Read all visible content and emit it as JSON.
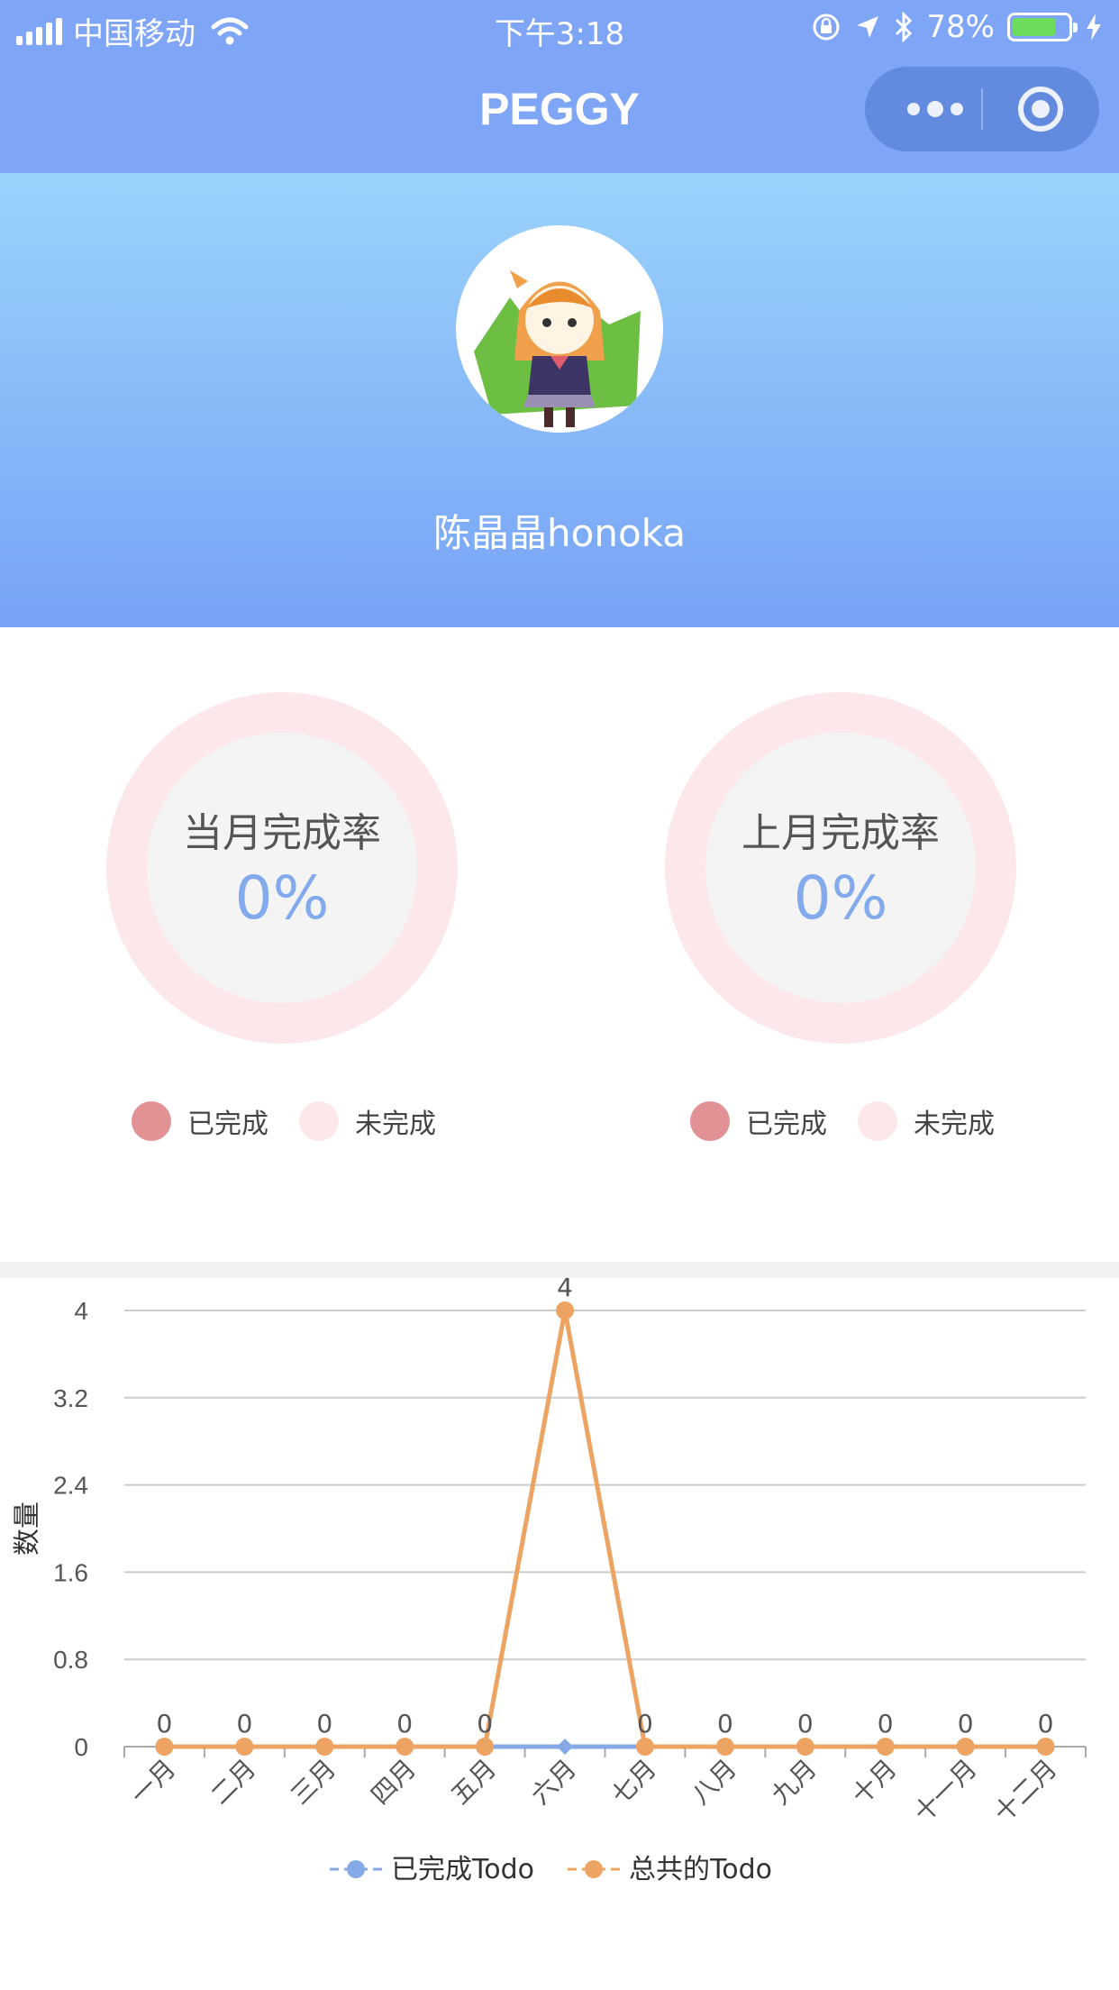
{
  "status_bar": {
    "carrier": "中国移动",
    "time": "下午3:18",
    "battery": "78%",
    "battery_level": 0.78
  },
  "nav": {
    "title": "PEGGY"
  },
  "profile": {
    "username": "陈晶晶honoka"
  },
  "rates": [
    {
      "label": "当月完成率",
      "value": "0%"
    },
    {
      "label": "上月完成率",
      "value": "0%"
    }
  ],
  "legend": {
    "done": "已完成",
    "undone": "未完成"
  },
  "colors": {
    "accent": "#7fa5f7",
    "done": "#e29195",
    "undone": "#fce8ea",
    "rate_text": "#83aaec",
    "series_done": "#85a9e6",
    "series_total": "#eda462"
  },
  "chart_data": {
    "type": "line",
    "categories": [
      "一月",
      "二月",
      "三月",
      "四月",
      "五月",
      "六月",
      "七月",
      "八月",
      "九月",
      "十月",
      "十一月",
      "十二月"
    ],
    "series": [
      {
        "name": "已完成Todo",
        "values": [
          0,
          0,
          0,
          0,
          0,
          0,
          0,
          0,
          0,
          0,
          0,
          0
        ]
      },
      {
        "name": "总共的Todo",
        "values": [
          0,
          0,
          0,
          0,
          0,
          4,
          0,
          0,
          0,
          0,
          0,
          0
        ]
      }
    ],
    "ylabel": "数量",
    "yticks": [
      "0",
      "0.8",
      "1.6",
      "2.4",
      "3.2",
      "4"
    ],
    "ylim": [
      0,
      4
    ],
    "grid": true,
    "legend_position": "bottom"
  }
}
